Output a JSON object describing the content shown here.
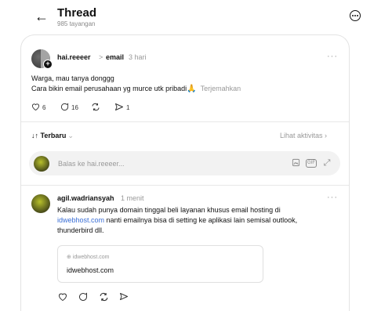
{
  "header": {
    "title": "Thread",
    "subtitle": "985 tayangan",
    "back_icon": "arrow-left-icon",
    "more_icon": "more-circle-icon"
  },
  "post": {
    "username": "hai.reeeer",
    "separator": ">",
    "topic": "email",
    "time": "3 hari",
    "more": "···",
    "line1": "Warga, mau tanya donggg",
    "line2": "Cara bikin email perusahaan yg murce utk pribadi",
    "emoji": "🙏",
    "translate": "Terjemahkan",
    "likes": "6",
    "replies": "16",
    "shares": "1"
  },
  "sort": {
    "label": "Terbaru",
    "icon": "↓↑",
    "activity": "Lihat aktivitas"
  },
  "reply_box": {
    "placeholder": "Balas ke hai.reeeer..."
  },
  "comment": {
    "username": "agil.wadriansyah",
    "time": "1 menit",
    "more": "···",
    "line1": "Kalau sudah punya domain tinggal beli layanan khusus email hosting di",
    "link": "idwebhost.com",
    "line2_rest": " nanti emailnya bisa di setting ke aplikasi lain semisal outlook,",
    "line3": "thunderbird dll.",
    "preview_domain": "idwebhost.com",
    "preview_title": "idwebhost.com"
  }
}
